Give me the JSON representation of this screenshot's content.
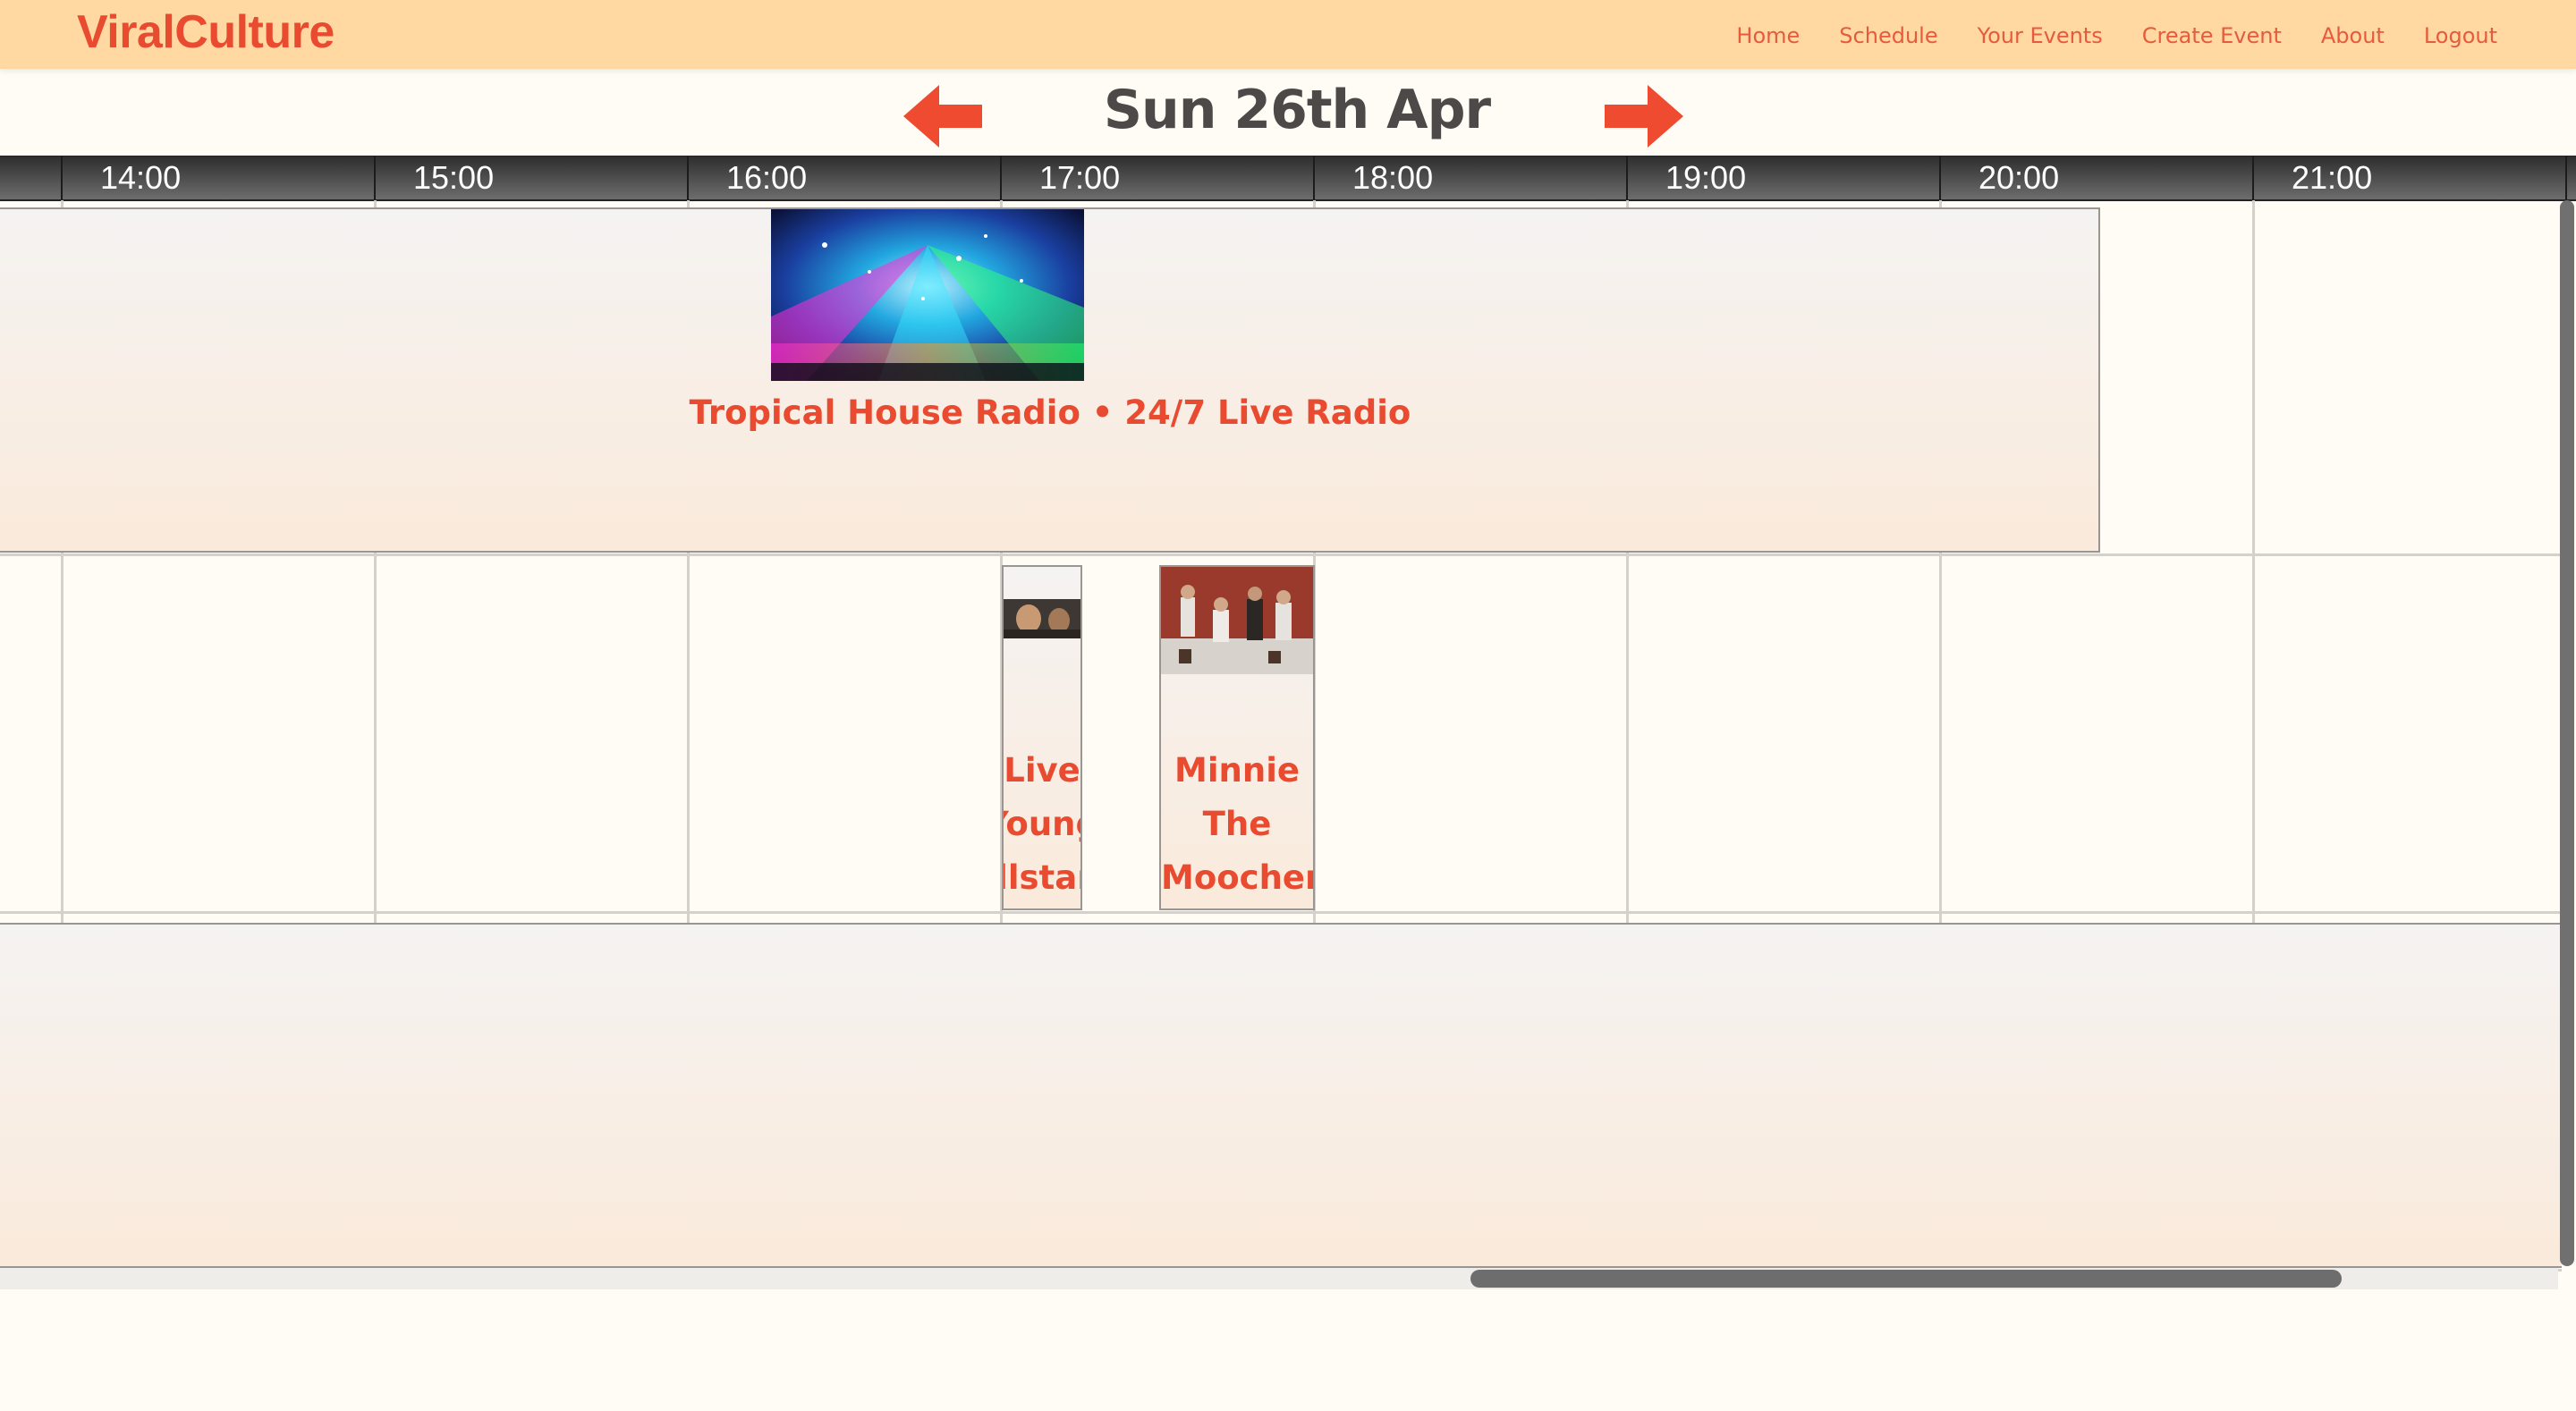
{
  "brand": {
    "name": "ViralCulture"
  },
  "nav": {
    "items": [
      "Home",
      "Schedule",
      "Your Events",
      "Create Event",
      "About",
      "Logout"
    ]
  },
  "date_header": {
    "title": "Sun 26th Apr",
    "prev_icon": "arrow-left-icon",
    "next_icon": "arrow-right-icon"
  },
  "timeline": {
    "hours": [
      "14:00",
      "15:00",
      "16:00",
      "17:00",
      "18:00",
      "19:00",
      "20:00",
      "21:00"
    ]
  },
  "events": [
    {
      "title": "Tropical House Radio • 24/7 Live Radio",
      "thumbnail": "concert-lights-image"
    },
    {
      "title": "Live Young Allstars",
      "thumbnail": "performers-image"
    },
    {
      "title": "Minnie The Moocher",
      "thumbnail": "band-photo-image"
    }
  ],
  "colors": {
    "accent": "#e94b31",
    "navbar_bg": "#ffd9a1",
    "page_bg": "#fffcf6",
    "header_dark": "#3a3a3a",
    "text_dark": "#4d4948"
  }
}
